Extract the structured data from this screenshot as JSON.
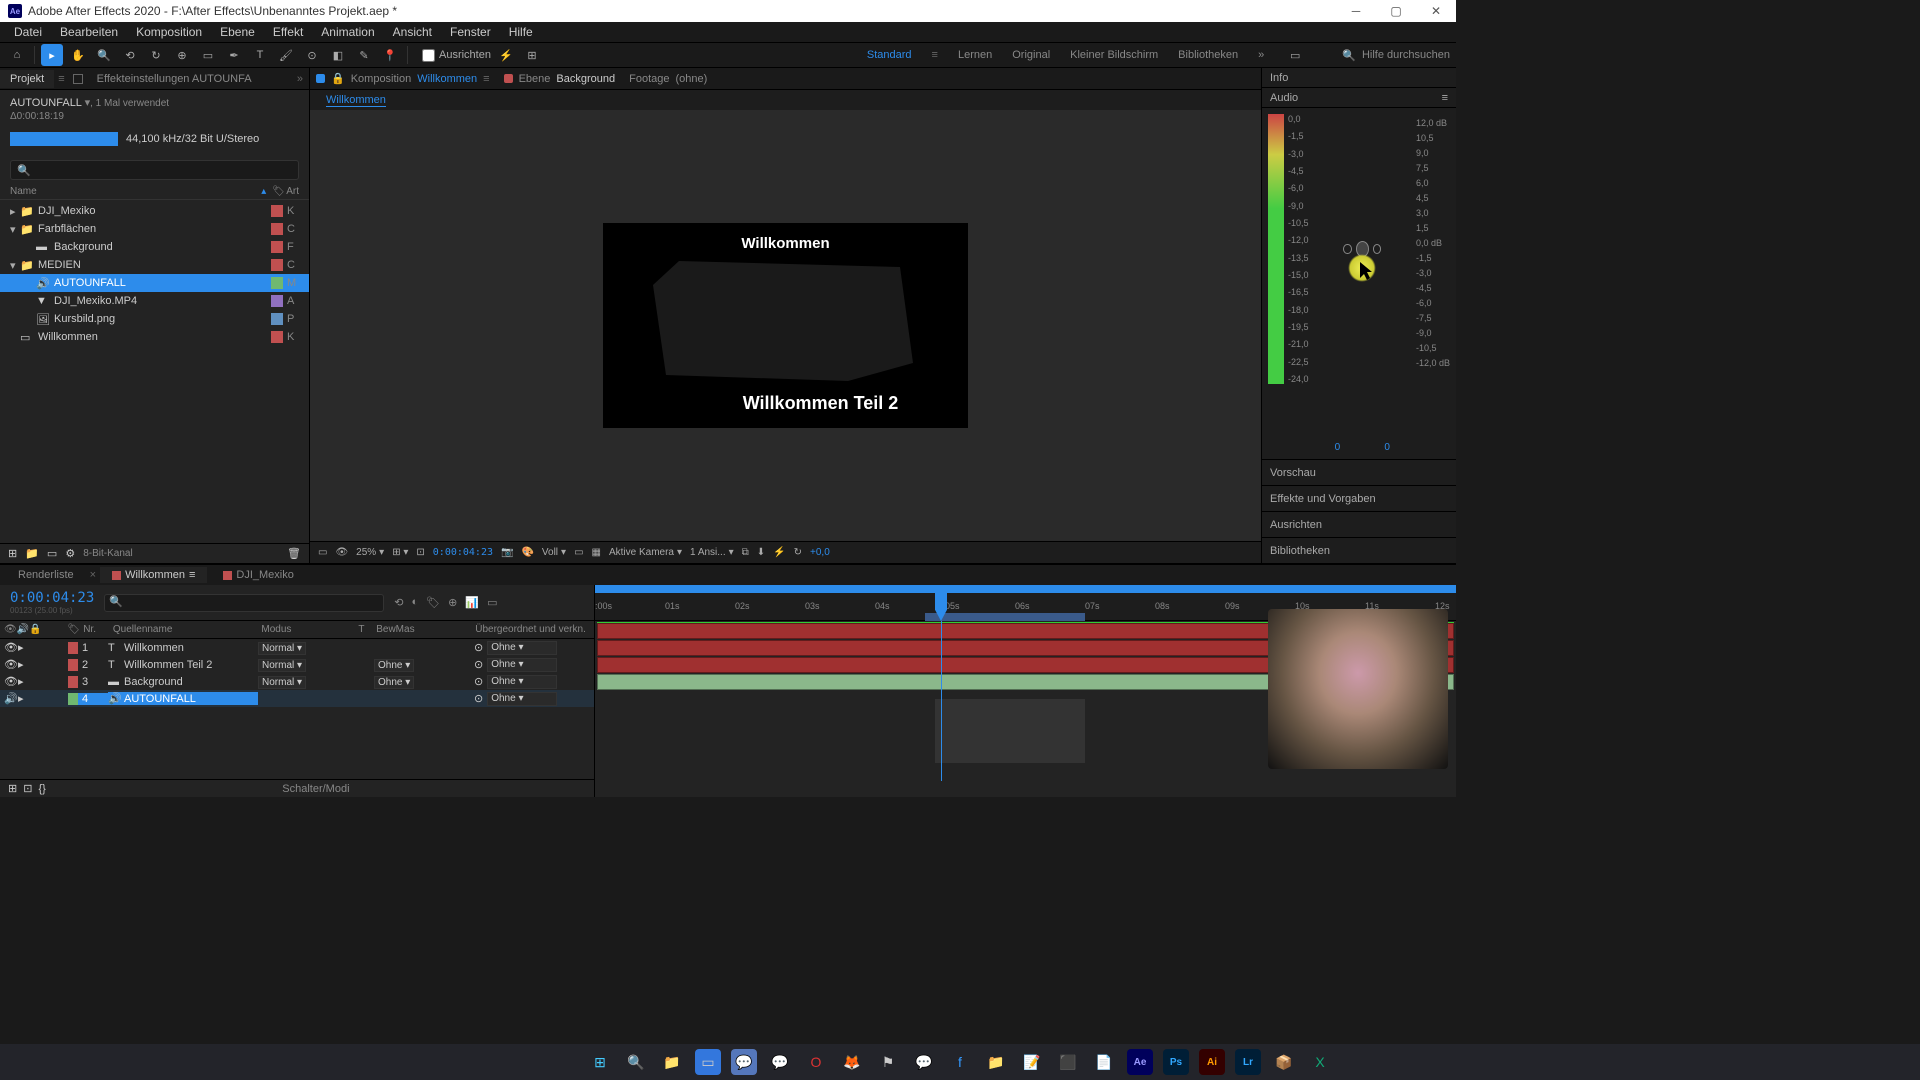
{
  "app": {
    "title": "Adobe After Effects 2020 - F:\\After Effects\\Unbenanntes Projekt.aep *",
    "icon": "Ae"
  },
  "menu": [
    "Datei",
    "Bearbeiten",
    "Komposition",
    "Ebene",
    "Effekt",
    "Animation",
    "Ansicht",
    "Fenster",
    "Hilfe"
  ],
  "toolbar": {
    "ausrichten": "Ausrichten",
    "workspaces": [
      "Standard",
      "Lernen",
      "Original",
      "Kleiner Bildschirm",
      "Bibliotheken"
    ],
    "active_workspace": "Standard",
    "search_placeholder": "Hilfe durchsuchen"
  },
  "project": {
    "tab_project": "Projekt",
    "tab_effects": "Effekteinstellungen AUTOUNFA",
    "asset_name": "AUTOUNFALL",
    "used": ", 1 Mal verwendet",
    "duration": "Δ0:00:18:19",
    "audio_meta": "44,100 kHz/32 Bit U/Stereo",
    "col_name": "Name",
    "col_art": "Art",
    "tree": [
      {
        "kind": "folder",
        "label": "DJI_Mexiko",
        "swatch": "#c05050",
        "type": "K",
        "indent": 0,
        "open": false
      },
      {
        "kind": "folder",
        "label": "Farbflächen",
        "swatch": "#c05050",
        "type": "C",
        "indent": 0,
        "open": true
      },
      {
        "kind": "solid",
        "label": "Background",
        "swatch": "#c05050",
        "type": "F",
        "indent": 1
      },
      {
        "kind": "folder",
        "label": "MEDIEN",
        "swatch": "#c05050",
        "type": "C",
        "indent": 0,
        "open": true
      },
      {
        "kind": "audio",
        "label": "AUTOUNFALL",
        "swatch": "#70b870",
        "type": "M",
        "indent": 1,
        "selected": true
      },
      {
        "kind": "video",
        "label": "DJI_Mexiko.MP4",
        "swatch": "#9070c0",
        "type": "A",
        "indent": 1
      },
      {
        "kind": "image",
        "label": "Kursbild.png",
        "swatch": "#6090c0",
        "type": "P",
        "indent": 1
      },
      {
        "kind": "comp",
        "label": "Willkommen",
        "swatch": "#c05050",
        "type": "K",
        "indent": 0
      }
    ],
    "footer_bit": "8-Bit-Kanal"
  },
  "comp": {
    "komposition_label": "Komposition",
    "komposition_name": "Willkommen",
    "ebene_label": "Ebene",
    "ebene_name": "Background",
    "footage_label": "Footage",
    "footage_name": "(ohne)",
    "breadcrumb": "Willkommen",
    "text1": "Willkommen",
    "text2": "Willkommen Teil 2"
  },
  "viewer_footer": {
    "zoom": "25%",
    "time": "0:00:04:23",
    "res": "Voll",
    "camera": "Aktive Kamera",
    "views": "1 Ansi...",
    "exposure": "+0,0"
  },
  "right": {
    "info": "Info",
    "audio": "Audio",
    "vu_left": [
      "0,0",
      "-1,5",
      "-3,0",
      "-4,5",
      "-6,0",
      "-9,0",
      "-10,5",
      "-12,0",
      "-13,5",
      "-15,0",
      "-16,5",
      "-18,0",
      "-19,5",
      "-21,0",
      "-22,5",
      "-24,0"
    ],
    "db_right": [
      "12,0 dB",
      "10,5",
      "9,0",
      "7,5",
      "6,0",
      "4,5",
      "3,0",
      "1,5",
      "0,0 dB",
      "-1,5",
      "-3,0",
      "-4,5",
      "-6,0",
      "-7,5",
      "-9,0",
      "-10,5",
      "-12,0 dB"
    ],
    "zero_l": "0",
    "zero_r": "0",
    "vorschau": "Vorschau",
    "effekte": "Effekte und Vorgaben",
    "ausrichten": "Ausrichten",
    "bibliotheken": "Bibliotheken"
  },
  "timeline": {
    "tabs": [
      "Renderliste",
      "Willkommen",
      "DJI_Mexiko"
    ],
    "active_tab": 1,
    "time": "0:00:04:23",
    "frames_sub": "00123 (25.00 fps)",
    "cols": {
      "nr": "Nr.",
      "name": "Quellenname",
      "mode": "Modus",
      "t": "T",
      "bew": "BewMas",
      "parent": "Übergeordnet und verkn."
    },
    "layers": [
      {
        "nr": "1",
        "name": "Willkommen",
        "type": "T",
        "mode": "Normal",
        "bew": "",
        "parent": "Ohne",
        "swatch": "#c05050"
      },
      {
        "nr": "2",
        "name": "Willkommen Teil 2",
        "type": "T",
        "mode": "Normal",
        "bew": "Ohne",
        "parent": "Ohne",
        "swatch": "#c05050"
      },
      {
        "nr": "3",
        "name": "Background",
        "type": "S",
        "mode": "Normal",
        "bew": "Ohne",
        "parent": "Ohne",
        "swatch": "#c05050"
      },
      {
        "nr": "4",
        "name": "AUTOUNFALL",
        "type": "A",
        "mode": "",
        "bew": "",
        "parent": "Ohne",
        "swatch": "#70b870",
        "selected": true
      }
    ],
    "ruler": [
      ":00s",
      "01s",
      "02s",
      "03s",
      "04s",
      "05s",
      "06s",
      "07s",
      "08s",
      "09s",
      "10s",
      "11s",
      "12s"
    ],
    "footer": "Schalter/Modi"
  }
}
